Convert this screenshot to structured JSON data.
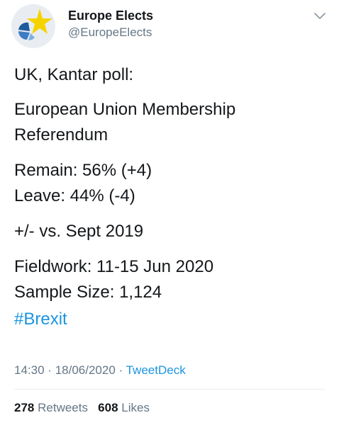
{
  "header": {
    "display_name": "Europe Elects",
    "handle": "@EuropeElects",
    "avatar_icon": "europe-elects-logo-icon",
    "menu_icon": "chevron-down-icon"
  },
  "tweet": {
    "line1": "UK, Kantar poll:",
    "line2": "European Union Membership",
    "line3": "Referendum",
    "line4": "Remain: 56% (+4)",
    "line5": "Leave: 44% (-4)",
    "line6": "+/- vs. Sept 2019",
    "line7": "Fieldwork: 11-15 Jun 2020",
    "line8": "Sample Size: 1,124",
    "hashtag": "#Brexit"
  },
  "meta": {
    "time": "14:30",
    "separator1": "·",
    "date": "18/06/2020",
    "separator2": "·",
    "source": "TweetDeck"
  },
  "stats": {
    "retweets_count": "278",
    "retweets_label": "Retweets",
    "likes_count": "608",
    "likes_label": "Likes"
  },
  "colors": {
    "link": "#1b95e0",
    "secondary_text": "#657786",
    "primary_text": "#14171a",
    "logo_yellow": "#f5d300",
    "logo_blue": "#1e5a9e"
  }
}
